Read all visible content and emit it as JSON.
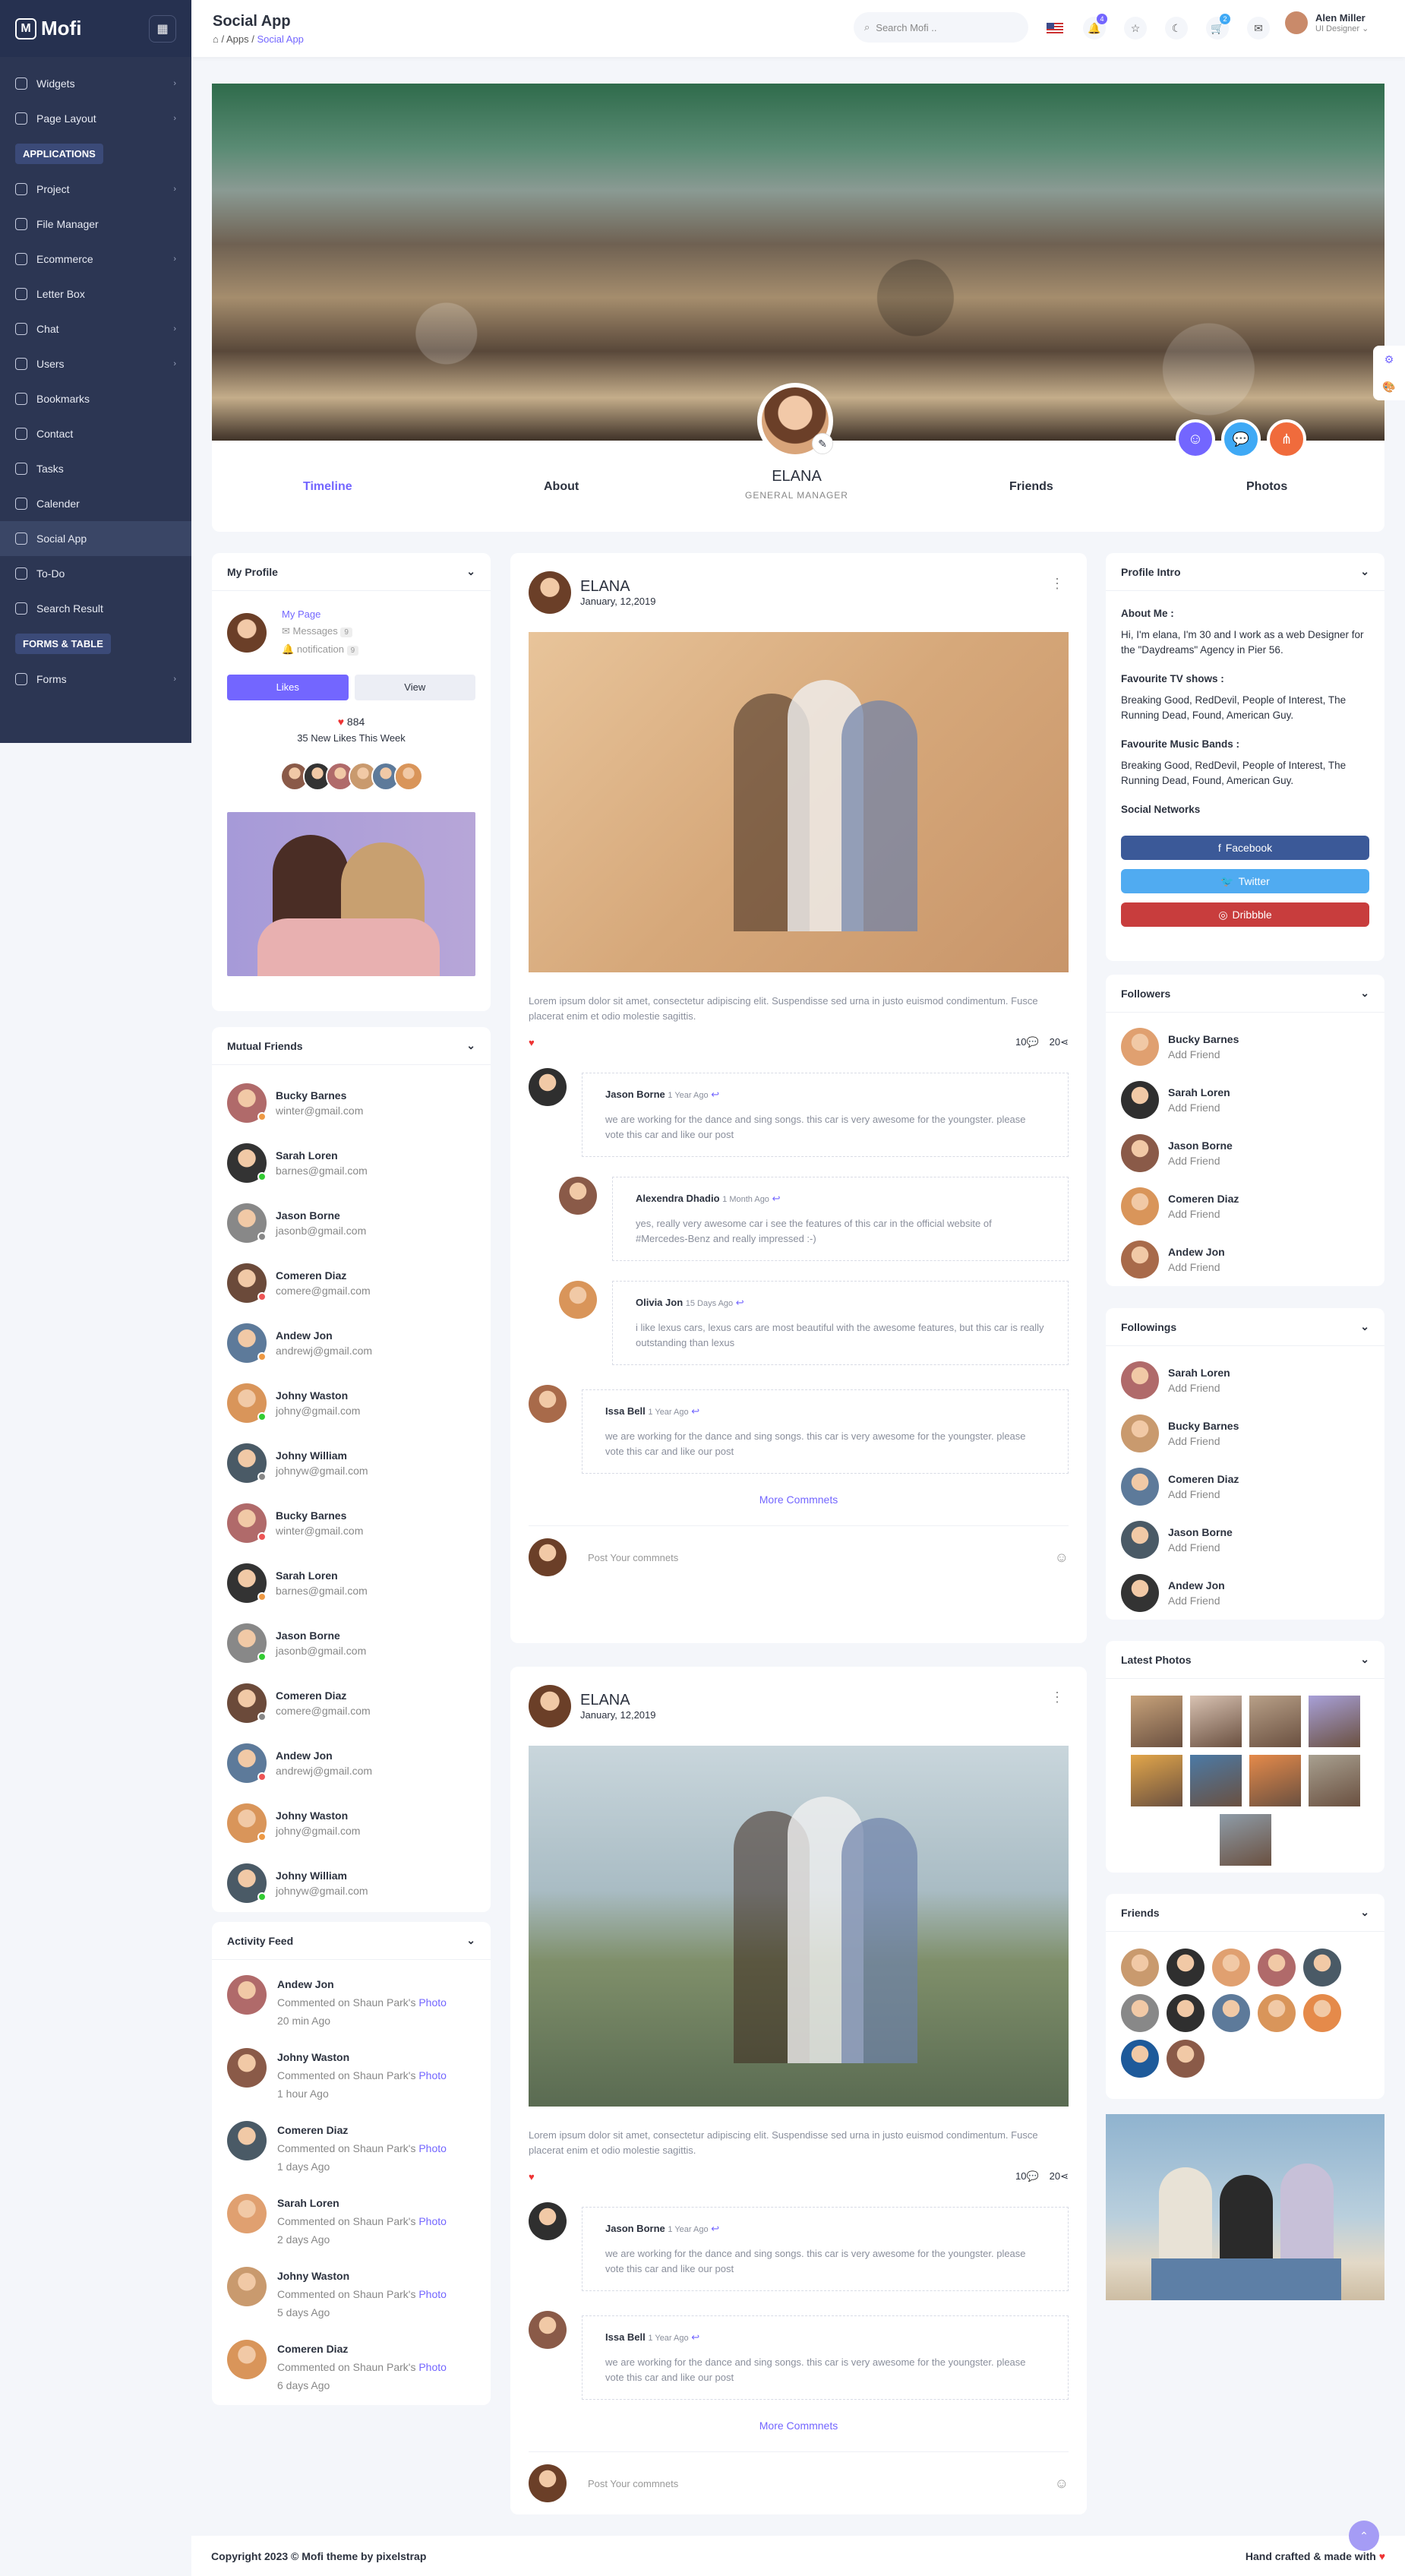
{
  "app": {
    "name": "Mofi"
  },
  "sidebar": {
    "items": [
      {
        "label": "Widgets",
        "arrow": true
      },
      {
        "label": "Page Layout",
        "arrow": true
      }
    ],
    "section1": "APPLICATIONS",
    "apps": [
      {
        "label": "Project",
        "arrow": true
      },
      {
        "label": "File Manager",
        "arrow": false
      },
      {
        "label": "Ecommerce",
        "arrow": true
      },
      {
        "label": "Letter Box",
        "arrow": false
      },
      {
        "label": "Chat",
        "arrow": true
      },
      {
        "label": "Users",
        "arrow": true
      },
      {
        "label": "Bookmarks",
        "arrow": false
      },
      {
        "label": "Contact",
        "arrow": false
      },
      {
        "label": "Tasks",
        "arrow": false
      },
      {
        "label": "Calender",
        "arrow": false
      },
      {
        "label": "Social App",
        "arrow": false
      },
      {
        "label": "To-Do",
        "arrow": false
      },
      {
        "label": "Search Result",
        "arrow": false
      }
    ],
    "section2": "FORMS & TABLE",
    "forms": [
      {
        "label": "Forms",
        "arrow": true
      }
    ]
  },
  "header": {
    "title": "Social App",
    "crumb_apps": "Apps",
    "crumb_current": "Social App",
    "search_placeholder": "Search Mofi ..",
    "badge_bell": "4",
    "badge_cart": "2",
    "user_name": "Alen Miller",
    "user_role": "UI Designer"
  },
  "profile": {
    "name": "ELANA",
    "role": "GENERAL MANAGER",
    "tabs": {
      "timeline": "Timeline",
      "about": "About",
      "friends": "Friends",
      "photos": "Photos"
    }
  },
  "my_profile": {
    "title": "My Profile",
    "page": "My Page",
    "messages": "Messages",
    "messages_count": "9",
    "notification": "notification",
    "notification_count": "9",
    "likes_btn": "Likes",
    "view_btn": "View",
    "likes": "884",
    "new_likes": "35 New Likes This Week"
  },
  "mutual": {
    "title": "Mutual Friends",
    "items": [
      {
        "name": "Bucky Barnes",
        "email": "winter@gmail.com",
        "c": "#b06a6a"
      },
      {
        "name": "Sarah Loren",
        "email": "barnes@gmail.com",
        "c": "#333"
      },
      {
        "name": "Jason Borne",
        "email": "jasonb@gmail.com",
        "c": "#888"
      },
      {
        "name": "Comeren Diaz",
        "email": "comere@gmail.com",
        "c": "#6b4a3a"
      },
      {
        "name": "Andew Jon",
        "email": "andrewj@gmail.com",
        "c": "#5d7a9a"
      },
      {
        "name": "Johny Waston",
        "email": "johny@gmail.com",
        "c": "#d9955a"
      },
      {
        "name": "Johny William",
        "email": "johnyw@gmail.com",
        "c": "#4a5a66"
      },
      {
        "name": "Bucky Barnes",
        "email": "winter@gmail.com",
        "c": "#b06a6a"
      },
      {
        "name": "Sarah Loren",
        "email": "barnes@gmail.com",
        "c": "#333"
      },
      {
        "name": "Jason Borne",
        "email": "jasonb@gmail.com",
        "c": "#888"
      },
      {
        "name": "Comeren Diaz",
        "email": "comere@gmail.com",
        "c": "#6b4a3a"
      },
      {
        "name": "Andew Jon",
        "email": "andrewj@gmail.com",
        "c": "#5d7a9a"
      },
      {
        "name": "Johny Waston",
        "email": "johny@gmail.com",
        "c": "#d9955a"
      },
      {
        "name": "Johny William",
        "email": "johnyw@gmail.com",
        "c": "#4a5a66"
      }
    ]
  },
  "activity": {
    "title": "Activity Feed",
    "items": [
      {
        "name": "Andew Jon",
        "text": "Commented on Shaun Park's",
        "link": "Photo",
        "time": "20 min Ago"
      },
      {
        "name": "Johny Waston",
        "text": "Commented on Shaun Park's",
        "link": "Photo",
        "time": "1 hour Ago"
      },
      {
        "name": "Comeren Diaz",
        "text": "Commented on Shaun Park's",
        "link": "Photo",
        "time": "1 days Ago"
      },
      {
        "name": "Sarah Loren",
        "text": "Commented on Shaun Park's",
        "link": "Photo",
        "time": "2 days Ago"
      },
      {
        "name": "Johny Waston",
        "text": "Commented on Shaun Park's",
        "link": "Photo",
        "time": "5 days Ago"
      },
      {
        "name": "Comeren Diaz",
        "text": "Commented on Shaun Park's",
        "link": "Photo",
        "time": "6 days Ago"
      }
    ]
  },
  "posts": [
    {
      "name": "ELANA",
      "date": "January, 12,2019",
      "text": "Lorem ipsum dolor sit amet, consectetur adipiscing elit. Suspendisse sed urna in justo euismod condimentum. Fusce placerat enim et odio molestie sagittis.",
      "c1": "10",
      "c2": "20",
      "comments": [
        {
          "name": "Jason Borne",
          "time": "1 Year Ago",
          "text": "we are working for the dance and sing songs. this car is very awesome for the youngster. please vote this car and like our post"
        },
        {
          "name": "Alexendra Dhadio",
          "time": "1 Month Ago",
          "text": "yes, really very awesome car i see the features of this car in the official website of #Mercedes-Benz and really impressed :-)"
        },
        {
          "name": "Olivia Jon",
          "time": "15 Days Ago",
          "text": "i like lexus cars, lexus cars are most beautiful with the awesome features, but this car is really outstanding than lexus"
        },
        {
          "name": "Issa Bell",
          "time": "1 Year Ago",
          "text": "we are working for the dance and sing songs. this car is very awesome for the youngster. please vote this car and like our post"
        }
      ],
      "more": "More Commnets",
      "placeholder": "Post Your commnets"
    },
    {
      "name": "ELANA",
      "date": "January, 12,2019",
      "text": "Lorem ipsum dolor sit amet, consectetur adipiscing elit. Suspendisse sed urna in justo euismod condimentum. Fusce placerat enim et odio molestie sagittis.",
      "c1": "10",
      "c2": "20",
      "comments": [
        {
          "name": "Jason Borne",
          "time": "1 Year Ago",
          "text": "we are working for the dance and sing songs. this car is very awesome for the youngster. please vote this car and like our post"
        },
        {
          "name": "Issa Bell",
          "time": "1 Year Ago",
          "text": "we are working for the dance and sing songs. this car is very awesome for the youngster. please vote this car and like our post"
        }
      ],
      "more": "More Commnets",
      "placeholder": "Post Your commnets"
    }
  ],
  "intro": {
    "title": "Profile Intro",
    "about_h": "About Me :",
    "about": "Hi, I'm elana, I'm 30 and I work as a web Designer for the \"Daydreams\" Agency in Pier 56.",
    "tv_h": "Favourite TV shows :",
    "tv": "Breaking Good, RedDevil, People of Interest, The Running Dead, Found, American Guy.",
    "music_h": "Favourite Music Bands :",
    "music": "Breaking Good, RedDevil, People of Interest, The Running Dead, Found, American Guy.",
    "social_h": "Social Networks",
    "facebook": "Facebook",
    "twitter": "Twitter",
    "dribbble": "Dribbble"
  },
  "followers": {
    "title": "Followers",
    "items": [
      {
        "name": "Bucky Barnes",
        "sub": "Add Friend"
      },
      {
        "name": "Sarah Loren",
        "sub": "Add Friend"
      },
      {
        "name": "Jason Borne",
        "sub": "Add Friend"
      },
      {
        "name": "Comeren Diaz",
        "sub": "Add Friend"
      },
      {
        "name": "Andew Jon",
        "sub": "Add Friend"
      }
    ]
  },
  "followings": {
    "title": "Followings",
    "items": [
      {
        "name": "Sarah Loren",
        "sub": "Add Friend"
      },
      {
        "name": "Bucky Barnes",
        "sub": "Add Friend"
      },
      {
        "name": "Comeren Diaz",
        "sub": "Add Friend"
      },
      {
        "name": "Jason Borne",
        "sub": "Add Friend"
      },
      {
        "name": "Andew Jon",
        "sub": "Add Friend"
      }
    ]
  },
  "latest_photos": {
    "title": "Latest Photos"
  },
  "friends": {
    "title": "Friends"
  },
  "footer": {
    "copyright": "Copyright 2023 © Mofi theme by pixelstrap",
    "made": "Hand crafted & made with"
  }
}
